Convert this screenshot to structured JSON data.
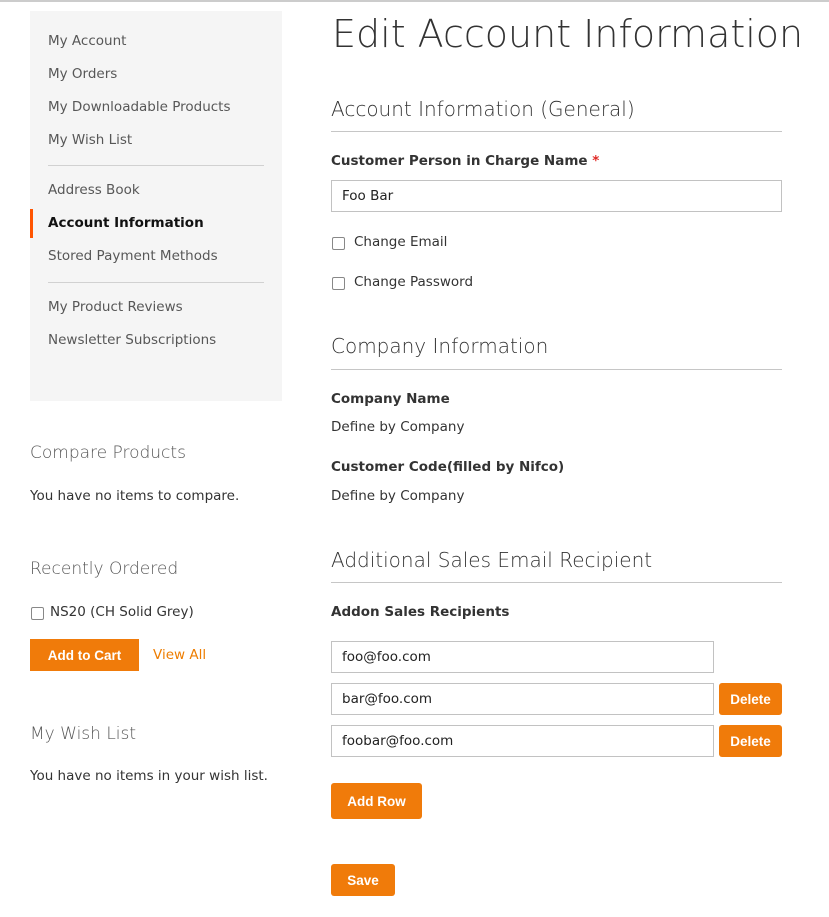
{
  "sidebar": {
    "items": [
      {
        "label": "My Account"
      },
      {
        "label": "My Orders"
      },
      {
        "label": "My Downloadable Products"
      },
      {
        "label": "My Wish List"
      },
      {
        "label": "Address Book"
      },
      {
        "label": "Account Information",
        "active": true
      },
      {
        "label": "Stored Payment Methods"
      },
      {
        "label": "My Product Reviews"
      },
      {
        "label": "Newsletter Subscriptions"
      }
    ]
  },
  "compare": {
    "title": "Compare Products",
    "empty": "You have no items to compare."
  },
  "recent": {
    "title": "Recently Ordered",
    "item": "NS20 (CH Solid Grey)",
    "add_to_cart": "Add to Cart",
    "view_all": "View All"
  },
  "wishlist": {
    "title": "My Wish List",
    "empty": "You have no items in your wish list."
  },
  "main": {
    "title": "Edit Account Information",
    "general": {
      "title": "Account Information (General)",
      "name_label": "Customer Person in Charge Name",
      "required": "*",
      "name_value": "Foo Bar",
      "change_email": "Change Email",
      "change_password": "Change Password"
    },
    "company": {
      "title": "Company Information",
      "name_label": "Company Name",
      "name_value": "Define by Company",
      "code_label": "Customer Code(filled by Nifco)",
      "code_value": "Define by Company"
    },
    "sales": {
      "title": "Additional Sales Email Recipient",
      "label": "Addon Sales Recipients",
      "recipients": [
        "foo@foo.com",
        "bar@foo.com",
        "foobar@foo.com"
      ],
      "delete": "Delete",
      "add_row": "Add Row"
    },
    "save": "Save"
  },
  "colors": {
    "accent": "#f07b0a",
    "active_bar": "#ff5501",
    "sidebar_bg": "#f5f5f5"
  }
}
